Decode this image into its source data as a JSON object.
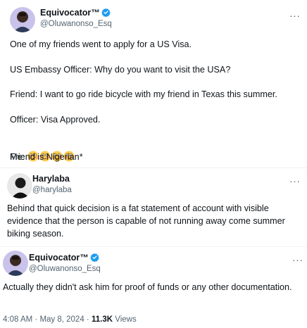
{
  "colors": {
    "verified_badge": "#1d9bf0",
    "secondary_text": "#536471",
    "primary_text": "#0f1419"
  },
  "tweet1": {
    "author_name": "Equivocator™",
    "verified": true,
    "handle": "@Oluwanonso_Esq",
    "more_icon": "more-dots-icon",
    "lines": [
      "One of my friends went to apply for a US Visa.",
      "US Embassy Officer: Why do you want to visit the USA?",
      "Friend: I want to go ride bicycle with my friend in Texas this summer.",
      "Officer: Visa Approved."
    ],
    "me_label": "Me: ",
    "me_emojis": [
      "flushed-face",
      "flushed-face",
      "flushed-face",
      "flushed-face"
    ],
    "last_line": "Friend is Nigerian*"
  },
  "reply": {
    "author_name": "Harylaba",
    "handle": "@harylaba",
    "more_icon": "more-dots-icon",
    "text": "Behind that quick decision is a fat statement of account with visible evidence that the person is capable of not running away come summer biking season."
  },
  "tweet2": {
    "author_name": "Equivocator™",
    "verified": true,
    "handle": "@Oluwanonso_Esq",
    "more_icon": "more-dots-icon",
    "text": "Actually they didn't ask him for proof of funds or any other documentation.",
    "time": "4:08 AM",
    "date": "May 8, 2024",
    "separator": " · ",
    "views_count": "11.3K",
    "views_label": " Views"
  }
}
